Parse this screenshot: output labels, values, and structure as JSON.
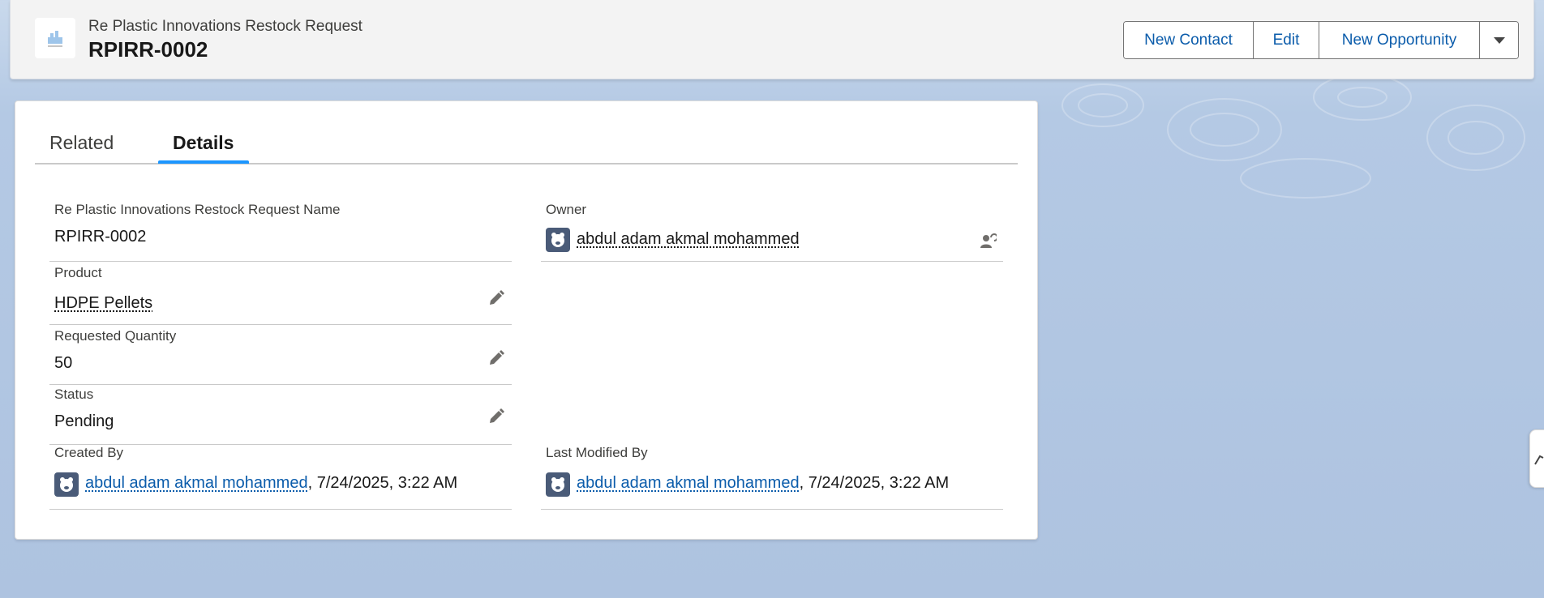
{
  "header": {
    "object_label": "Re Plastic Innovations Restock Request",
    "record_name": "RPIRR-0002",
    "icon": "record-object-icon",
    "actions": {
      "new_contact": "New Contact",
      "edit": "Edit",
      "new_opportunity": "New Opportunity",
      "more_icon": "chevron-down-icon"
    }
  },
  "tabs": {
    "related": "Related",
    "details": "Details",
    "active": "Details"
  },
  "fields": {
    "name": {
      "label": "Re Plastic Innovations Restock Request Name",
      "value": "RPIRR-0002"
    },
    "owner": {
      "label": "Owner",
      "value": "abdul adam akmal mohammed"
    },
    "product": {
      "label": "Product",
      "value": "HDPE Pellets"
    },
    "requested_quantity": {
      "label": "Requested Quantity",
      "value": "50"
    },
    "status": {
      "label": "Status",
      "value": "Pending"
    },
    "created_by": {
      "label": "Created By",
      "user": "abdul adam akmal mohammed",
      "timestamp": ", 7/24/2025, 3:22 AM"
    },
    "last_modified_by": {
      "label": "Last Modified By",
      "user": "abdul adam akmal mohammed",
      "timestamp": ", 7/24/2025, 3:22 AM"
    }
  },
  "colors": {
    "link": "#0b5cab",
    "active_tab": "#1b96ff",
    "avatar_bg": "#4a5b78"
  }
}
